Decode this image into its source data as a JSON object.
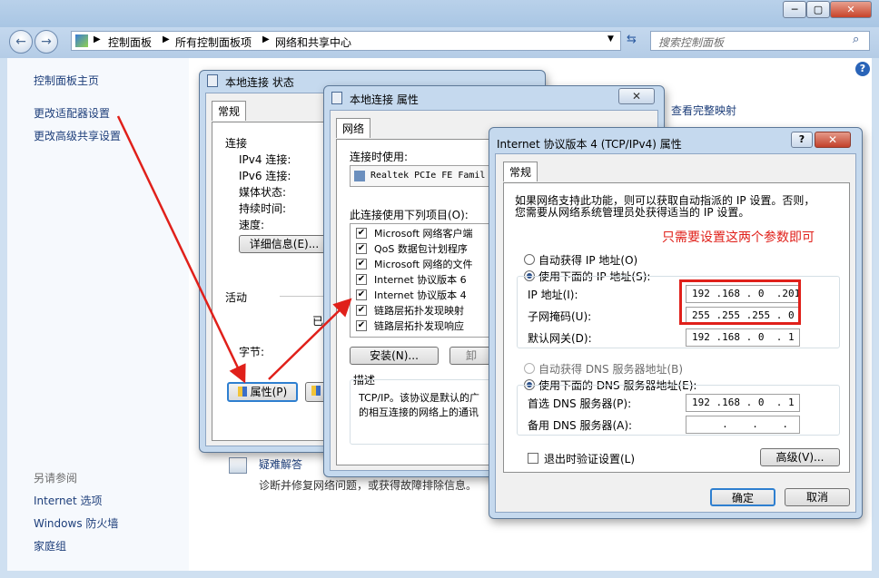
{
  "explorer": {
    "breadcrumb": [
      "控制面板",
      "所有控制面板项",
      "网络和共享中心"
    ],
    "search_placeholder": "搜索控制面板",
    "sidebar": {
      "home": "控制面板主页",
      "items": [
        "更改适配器设置",
        "更改高级共享设置"
      ],
      "see_also_title": "另请参阅",
      "see_also": [
        "Internet 选项",
        "Windows 防火墙",
        "家庭组"
      ]
    },
    "view_map_link": "查看完整映射",
    "troubleshoot": "疑难解答",
    "troubleshoot_desc": "诊断并修复网络问题，或获得故障排除信息。"
  },
  "status_dialog": {
    "title": "本地连接 状态",
    "tab": "常规",
    "section_connection": "连接",
    "rows": [
      "IPv4 连接:",
      "IPv6 连接:",
      "媒体状态:",
      "持续时间:",
      "速度:"
    ],
    "details_button": "详细信息(E)...",
    "section_activity": "活动",
    "sent_fragment": "已",
    "bytes_label": "字节:",
    "properties_button": "属性(P)"
  },
  "properties_dialog": {
    "title": "本地连接 属性",
    "tab": "网络",
    "connect_using_label": "连接时使用:",
    "adapter": "Realtek PCIe FE Famil",
    "items_label": "此连接使用下列项目(O):",
    "items": [
      "Microsoft 网络客户端",
      "QoS 数据包计划程序",
      "Microsoft 网络的文件",
      "Internet 协议版本 6",
      "Internet 协议版本 4",
      "链路层拓扑发现映射",
      "链路层拓扑发现响应"
    ],
    "install_button": "安装(N)...",
    "uninstall_fragment": "卸",
    "description_title": "描述",
    "description_text": "TCP/IP。该协议是默认的广域网络协议，它提供在不同的相互连接的网络上的通讯。",
    "description_line1": "TCP/IP。该协议是默认的广",
    "description_line2": "的相互连接的网络上的通讯"
  },
  "ipv4_dialog": {
    "title": "Internet 协议版本 4 (TCP/IPv4) 属性",
    "help": "?",
    "tab": "常规",
    "intro_line1": "如果网络支持此功能，则可以获取自动指派的 IP 设置。否则，",
    "intro_line2": "您需要从网络系统管理员处获得适当的 IP 设置。",
    "annotation": "只需要设置这两个参数即可",
    "annotation_color": "#e0201a",
    "auto_ip": "自动获得 IP 地址(O)",
    "manual_ip": "使用下面的 IP 地址(S):",
    "ip_label": "IP 地址(I):",
    "ip_value": "192 .168 . 0  .201",
    "mask_label": "子网掩码(U):",
    "mask_value": "255 .255 .255 . 0",
    "gateway_label": "默认网关(D):",
    "gateway_value": "192 .168 . 0  . 1",
    "auto_dns": "自动获得 DNS 服务器地址(B)",
    "manual_dns": "使用下面的 DNS 服务器地址(E):",
    "dns1_label": "首选 DNS 服务器(P):",
    "dns1_value": "192 .168 . 0  . 1",
    "dns2_label": "备用 DNS 服务器(A):",
    "dns2_value": "     .    .    .",
    "validate_label": "退出时验证设置(L)",
    "advanced_button": "高级(V)...",
    "ok_button": "确定",
    "cancel_button": "取消"
  }
}
